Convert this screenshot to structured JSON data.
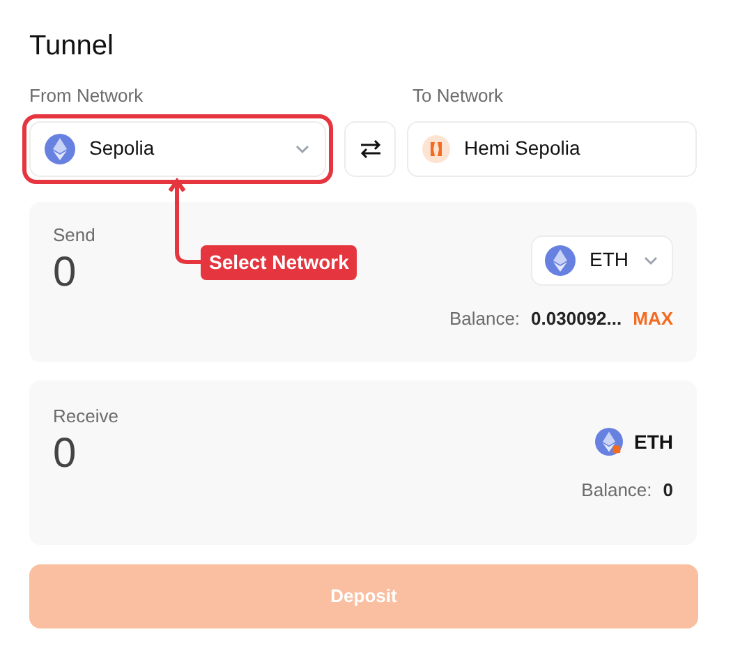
{
  "title": "Tunnel",
  "from": {
    "label": "From Network",
    "network": "Sepolia"
  },
  "to": {
    "label": "To Network",
    "network": "Hemi Sepolia"
  },
  "annotation": {
    "text": "Select Network"
  },
  "send": {
    "label": "Send",
    "amount": "0",
    "token": "ETH",
    "balance_label": "Balance:",
    "balance": "0.030092...",
    "max": "MAX"
  },
  "receive": {
    "label": "Receive",
    "amount": "0",
    "token": "ETH",
    "balance_label": "Balance:",
    "balance": "0"
  },
  "deposit": {
    "label": "Deposit",
    "disabled": true
  }
}
